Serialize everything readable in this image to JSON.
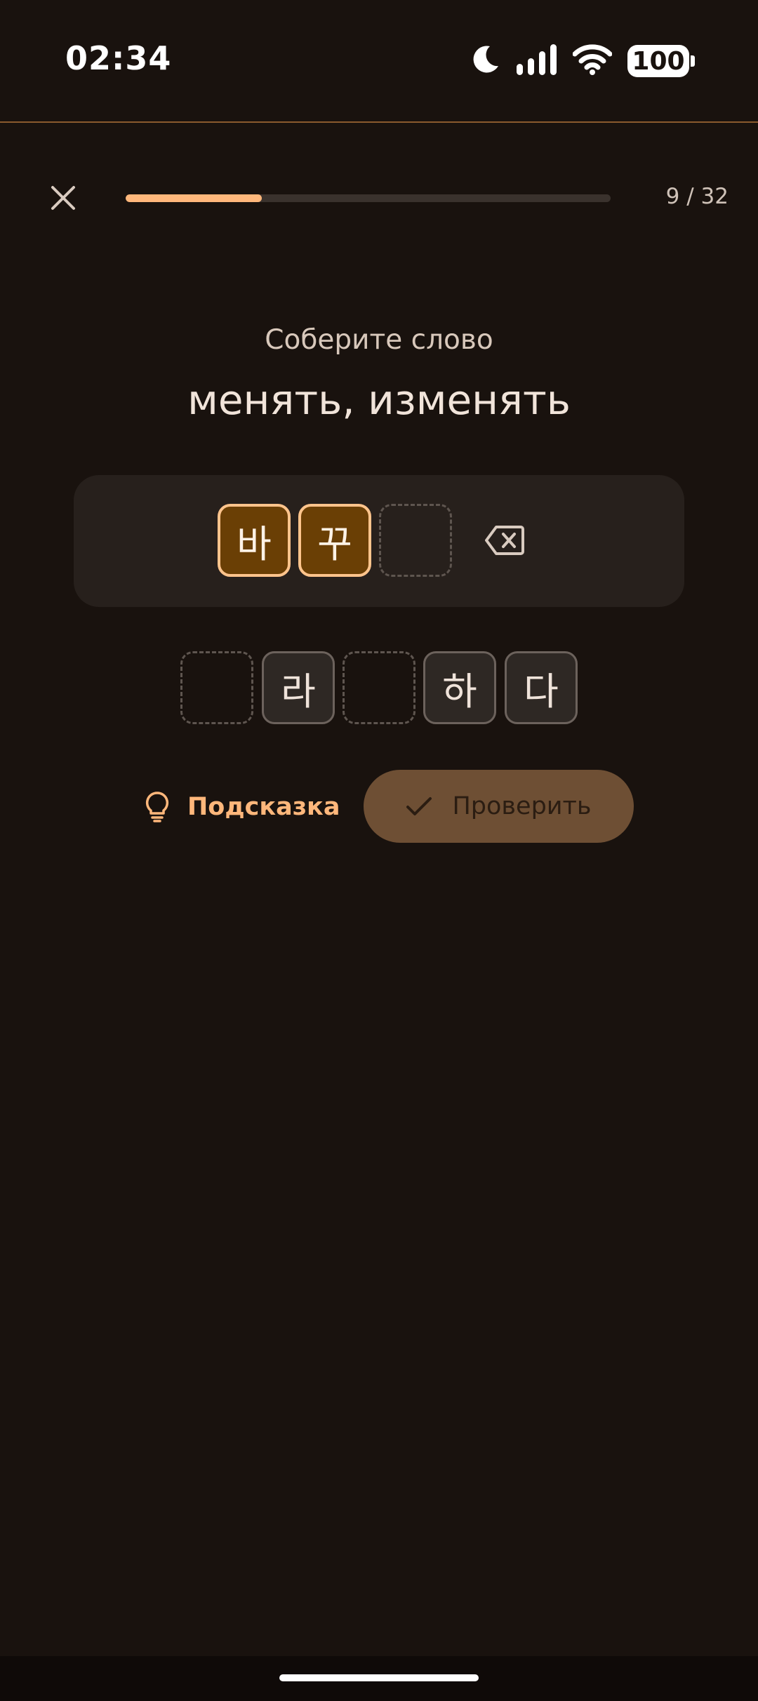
{
  "status_bar": {
    "time": "02:34",
    "battery_level": "100",
    "icons": [
      "moon-icon",
      "signal-icon",
      "wifi-icon",
      "battery-icon"
    ]
  },
  "progress": {
    "current": 9,
    "total": 32,
    "label": "9 / 32"
  },
  "prompt": {
    "instruction": "Соберите слово",
    "word": "менять, изменять"
  },
  "answer": {
    "slots": [
      "바",
      "꾸",
      ""
    ]
  },
  "choices": [
    "",
    "라",
    "",
    "하",
    "다"
  ],
  "actions": {
    "hint_label": "Подсказка",
    "check_label": "Проверить"
  },
  "colors": {
    "background": "#19120e",
    "accent": "#ffb77b",
    "tile_filled": "#6a3f05",
    "check_button": "#6e4f34"
  }
}
